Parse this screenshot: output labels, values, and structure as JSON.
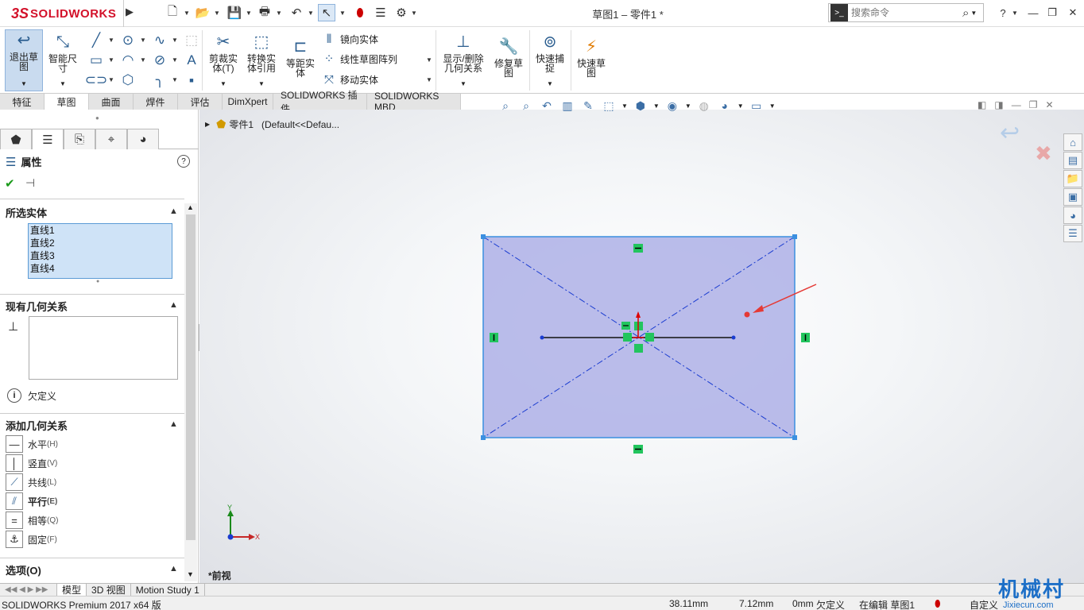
{
  "app": {
    "brand_ds": "3S",
    "brand_name": "SOLIDWORKS",
    "doc_title": "草图1 – 零件1 *"
  },
  "search": {
    "placeholder": "搜索命令"
  },
  "ribbon": {
    "exit_sketch": "退出草图",
    "smart_dim": "智能尺寸",
    "trim": "剪裁实体(T)",
    "convert": "转换实体引用",
    "offset": "等距实体",
    "mirror": "镜向实体",
    "linear_pattern": "线性草图阵列",
    "move": "移动实体",
    "show_relations": "显示/删除几何关系",
    "repair": "修复草图",
    "quick_snap": "快速捕捉",
    "rapid_sketch": "快速草图"
  },
  "tabs": [
    "特征",
    "草图",
    "曲面",
    "焊件",
    "评估",
    "DimXpert",
    "SOLIDWORKS 插件",
    "SOLIDWORKS MBD"
  ],
  "active_tab": 1,
  "panel": {
    "title": "属性",
    "selected_title": "所选实体",
    "selected_items": [
      "直线1",
      "直线2",
      "直线3",
      "直线4"
    ],
    "existing_title": "现有几何关系",
    "status": "欠定义",
    "add_title": "添加几何关系",
    "relations": [
      {
        "label": "水平",
        "key": "(H)"
      },
      {
        "label": "竖直",
        "key": "(V)"
      },
      {
        "label": "共线",
        "key": "(L)"
      },
      {
        "label": "平行",
        "key": "(E)"
      },
      {
        "label": "相等",
        "key": "(Q)"
      },
      {
        "label": "固定",
        "key": "(F)"
      }
    ],
    "options_title": "选项(O)"
  },
  "tree": {
    "part": "零件1",
    "config": "(Default<<Defau..."
  },
  "view_label": "*前视",
  "triad": {
    "x": "X",
    "y": "Y"
  },
  "bottom_tabs": [
    "模型",
    "3D 视图",
    "Motion Study 1"
  ],
  "status_bar": {
    "product": "SOLIDWORKS Premium 2017 x64 版",
    "x": "38.11mm",
    "y": "7.12mm",
    "z": "0mm",
    "definition": "欠定义",
    "editing": "在编辑 草图1",
    "custom": "自定义"
  },
  "watermark": {
    "main": "机械村",
    "sub": "Jixiecun.com"
  },
  "colors": {
    "accent": "#2a5d8f",
    "sketch_fill": "#aeb0e6",
    "sketch_line": "#1a3cd0",
    "relation_green": "#22c55e",
    "brand_red": "#d3112a"
  }
}
